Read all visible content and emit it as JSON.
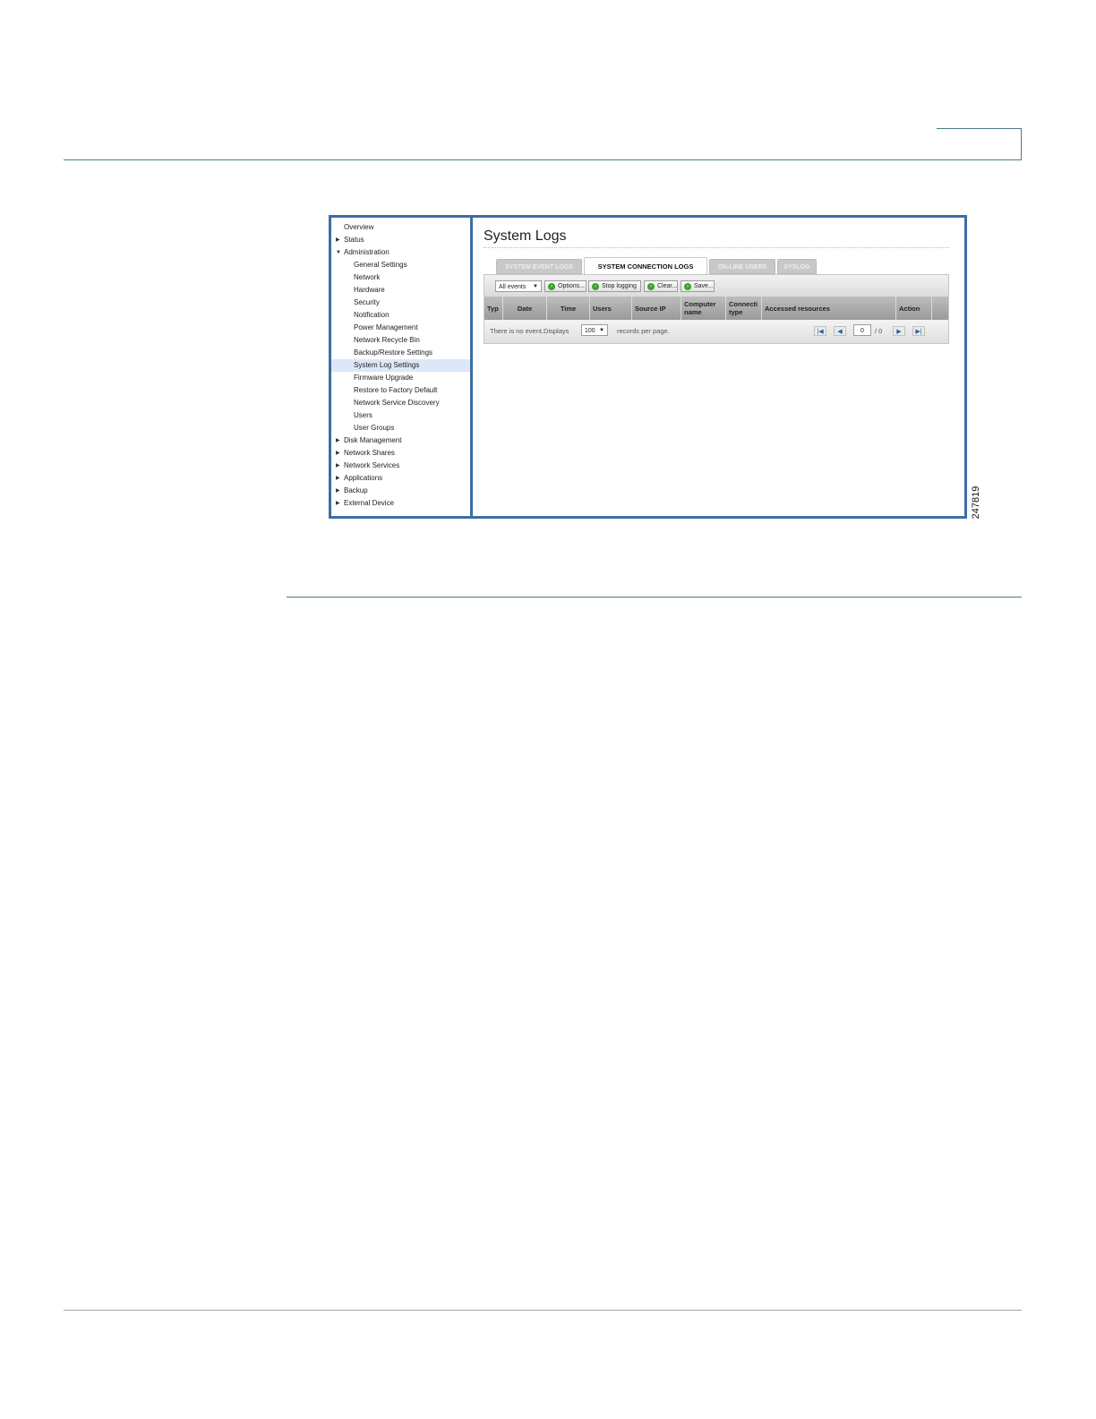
{
  "figure": {
    "number": "247819"
  },
  "nav": {
    "items": [
      {
        "label": "Overview",
        "level": "top",
        "arrow": "",
        "selected": false
      },
      {
        "label": "Status",
        "level": "top",
        "arrow": "▶",
        "selected": false
      },
      {
        "label": "Administration",
        "level": "top",
        "arrow": "▼",
        "selected": false
      },
      {
        "label": "General Settings",
        "level": "sub",
        "arrow": "",
        "selected": false
      },
      {
        "label": "Network",
        "level": "sub",
        "arrow": "",
        "selected": false
      },
      {
        "label": "Hardware",
        "level": "sub",
        "arrow": "",
        "selected": false
      },
      {
        "label": "Security",
        "level": "sub",
        "arrow": "",
        "selected": false
      },
      {
        "label": "Notification",
        "level": "sub",
        "arrow": "",
        "selected": false
      },
      {
        "label": "Power Management",
        "level": "sub",
        "arrow": "",
        "selected": false
      },
      {
        "label": "Network Recycle Bin",
        "level": "sub",
        "arrow": "",
        "selected": false
      },
      {
        "label": "Backup/Restore Settings",
        "level": "sub",
        "arrow": "",
        "selected": false
      },
      {
        "label": "System Log Settings",
        "level": "sub",
        "arrow": "",
        "selected": true
      },
      {
        "label": "Firmware Upgrade",
        "level": "sub",
        "arrow": "",
        "selected": false
      },
      {
        "label": "Restore to Factory Default",
        "level": "sub",
        "arrow": "",
        "selected": false
      },
      {
        "label": "Network Service Discovery",
        "level": "sub",
        "arrow": "",
        "selected": false
      },
      {
        "label": "Users",
        "level": "sub",
        "arrow": "",
        "selected": false
      },
      {
        "label": "User Groups",
        "level": "sub",
        "arrow": "",
        "selected": false
      },
      {
        "label": "Disk Management",
        "level": "top",
        "arrow": "▶",
        "selected": false
      },
      {
        "label": "Network Shares",
        "level": "top",
        "arrow": "▶",
        "selected": false
      },
      {
        "label": "Network Services",
        "level": "top",
        "arrow": "▶",
        "selected": false
      },
      {
        "label": "Applications",
        "level": "top",
        "arrow": "▶",
        "selected": false
      },
      {
        "label": "Backup",
        "level": "top",
        "arrow": "▶",
        "selected": false
      },
      {
        "label": "External Device",
        "level": "top",
        "arrow": "▶",
        "selected": false
      }
    ]
  },
  "main": {
    "title": "System Logs",
    "tabs": [
      {
        "label": "SYSTEM EVENT LOGS",
        "active": false
      },
      {
        "label": "SYSTEM CONNECTION LOGS",
        "active": true
      },
      {
        "label": "ON-LINE USERS",
        "active": false
      },
      {
        "label": "SYSLOG",
        "active": false
      }
    ],
    "toolbar": {
      "filter_value": "All events",
      "buttons": [
        {
          "label": "Options..."
        },
        {
          "label": "Stop logging"
        },
        {
          "label": "Clear..."
        },
        {
          "label": "Save..."
        }
      ]
    },
    "table": {
      "columns": [
        "Type",
        "Date",
        "Time",
        "Users",
        "Source IP",
        "Computer name",
        "Connection type",
        "Accessed resources",
        "Action"
      ],
      "column_display": [
        "Typ",
        "Date",
        "Time",
        "Users",
        "Source IP",
        "Computer\nname",
        "Connecti\ntype",
        "Accessed resources",
        "Action"
      ]
    },
    "pager": {
      "empty_text": "There is no event.Displays",
      "per_page": "100",
      "per_page_suffix": "records per page.",
      "page_value": "0",
      "page_total": "/ 0"
    }
  },
  "colors": {
    "frame": "#3d6ea3",
    "rule": "#4e7a86",
    "selected_nav": "#dce8f7",
    "button_icon": "#3aa329"
  }
}
